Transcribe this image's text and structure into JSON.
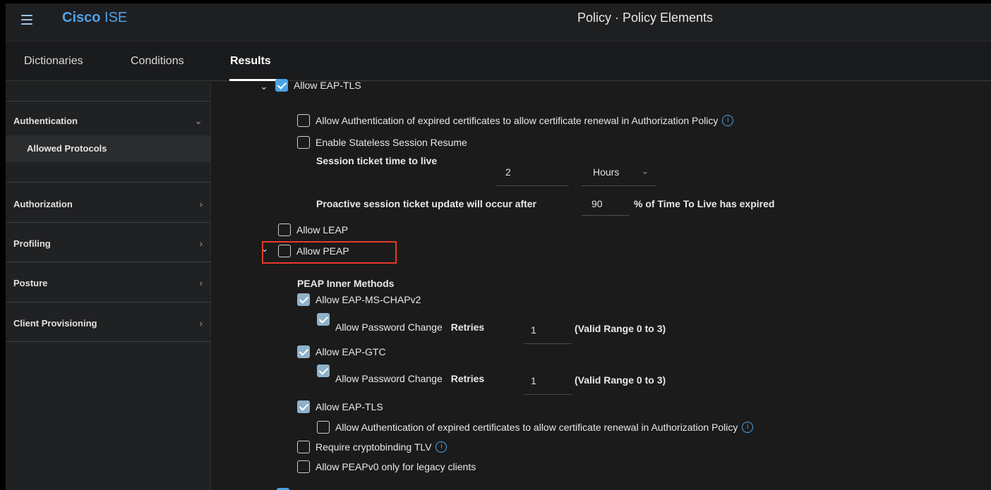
{
  "header": {
    "brand_bold": "Cisco",
    "brand_light": "ISE",
    "title": "Policy · Policy Elements"
  },
  "tabs": [
    {
      "label": "Dictionaries"
    },
    {
      "label": "Conditions"
    },
    {
      "label": "Results"
    }
  ],
  "sidebar": {
    "items": [
      {
        "label": "Authentication"
      },
      {
        "label": "Allowed Protocols"
      },
      {
        "label": "Authorization"
      },
      {
        "label": "Profiling"
      },
      {
        "label": "Posture"
      },
      {
        "label": "Client Provisioning"
      }
    ]
  },
  "main": {
    "eap_tls": {
      "label": "Allow EAP-TLS",
      "expired_cert": "Allow Authentication of expired certificates to allow certificate renewal in Authorization Policy",
      "stateless": "Enable Stateless Session Resume",
      "ttl_label": "Session ticket time to live",
      "ttl_value": "2",
      "ttl_unit": "Hours",
      "proactive_label": "Proactive session ticket update will occur after",
      "proactive_value": "90",
      "proactive_suffix": "% of Time To Live has expired"
    },
    "leap": {
      "label": "Allow LEAP"
    },
    "peap": {
      "label": "Allow PEAP",
      "inner_methods": "PEAP Inner Methods",
      "ms_chapv2": "Allow EAP-MS-CHAPv2",
      "ms_pw_change": "Allow Password Change",
      "ms_retries_label": "Retries",
      "ms_retries_value": "1",
      "ms_range": "(Valid Range 0 to 3)",
      "gtc": "Allow EAP-GTC",
      "gtc_pw_change": "Allow Password Change",
      "gtc_retries_label": "Retries",
      "gtc_retries_value": "1",
      "gtc_range": "(Valid Range 0 to 3)",
      "eap_tls": "Allow EAP-TLS",
      "eap_tls_expired": "Allow Authentication of expired certificates to allow certificate renewal in Authorization Policy",
      "cryptobinding": "Require cryptobinding TLV",
      "peapv0": "Allow PEAPv0 only for legacy clients"
    }
  },
  "colors": {
    "accent": "#4fa3e8",
    "highlight": "#e53a2a",
    "checked_disabled": "#8fb1c9"
  },
  "icons": {
    "menu": "hamburger-icon",
    "chevron": "chevron-icon",
    "info": "info-icon"
  }
}
